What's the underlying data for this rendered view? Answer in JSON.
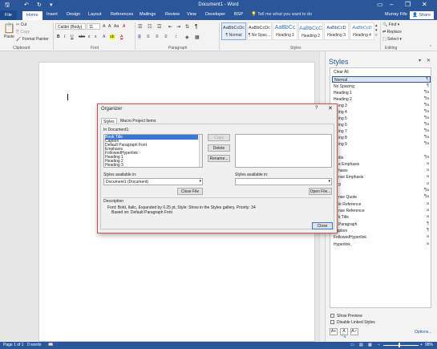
{
  "window": {
    "title": "Document1 - Word"
  },
  "quick_access": [
    "save-icon",
    "undo-icon",
    "redo-icon",
    "customize-icon"
  ],
  "window_controls": [
    "ribbon-display-icon",
    "minimize-icon",
    "restore-icon",
    "close-icon"
  ],
  "tabs": [
    "File",
    "Home",
    "Insert",
    "Design",
    "Layout",
    "References",
    "Mailings",
    "Review",
    "View",
    "Developer",
    "BSP"
  ],
  "tell_me": "Tell me what you want to do",
  "user": "Murray Fife",
  "share": "Share",
  "ribbon": {
    "clipboard": {
      "paste": "Paste",
      "cut": "Cut",
      "copy": "Copy",
      "format_painter": "Format Painter",
      "label": "Clipboard"
    },
    "font": {
      "name": "Calibri (Body)",
      "size": "11",
      "grow": "A",
      "shrink": "A",
      "case": "Aa",
      "clear": "A",
      "bold": "B",
      "italic": "I",
      "underline": "U",
      "strike": "abc",
      "sub": "x",
      "sup": "x",
      "effects": "A",
      "highlight": "ab",
      "color": "A",
      "label": "Font"
    },
    "paragraph": {
      "label": "Paragraph",
      "show": "¶"
    },
    "styles": {
      "label": "Styles",
      "tiles": [
        {
          "preview": "AaBbCcDc",
          "name": "¶ Normal"
        },
        {
          "preview": "AaBbCcDc",
          "name": "¶ No Spac..."
        },
        {
          "preview": "AaBbCc",
          "name": "Heading 1"
        },
        {
          "preview": "AaBbCcC",
          "name": "Heading 2"
        },
        {
          "preview": "AaBbCcD",
          "name": "Heading 3"
        },
        {
          "preview": "AaBbCcD",
          "name": "Heading 4"
        }
      ]
    },
    "editing": {
      "find": "Find",
      "replace": "Replace",
      "select": "Select",
      "label": "Editing"
    }
  },
  "styles_pane": {
    "title": "Styles",
    "items": [
      {
        "label": "Clear All",
        "indicator": ""
      },
      {
        "label": "Normal",
        "indicator": "¶"
      },
      {
        "label": "No Spacing",
        "indicator": "¶"
      },
      {
        "label": "Heading 1",
        "indicator": "¶a"
      },
      {
        "label": "Heading 2",
        "indicator": "¶a"
      },
      {
        "label": "ing 3",
        "indicator": "¶a"
      },
      {
        "label": "ing 4",
        "indicator": "¶a"
      },
      {
        "label": "ing 5",
        "indicator": "¶a"
      },
      {
        "label": "ing 6",
        "indicator": "¶a"
      },
      {
        "label": "ing 7",
        "indicator": "¶a"
      },
      {
        "label": "ing 8",
        "indicator": "¶a"
      },
      {
        "label": "ing 9",
        "indicator": "¶a"
      },
      {
        "label": "",
        "indicator": ""
      },
      {
        "label": "itle",
        "indicator": "¶a"
      },
      {
        "label": "e Emphasis",
        "indicator": "a"
      },
      {
        "label": "hasis",
        "indicator": "a"
      },
      {
        "label": "nse Emphasis",
        "indicator": "a"
      },
      {
        "label": "g",
        "indicator": "a"
      },
      {
        "label": "",
        "indicator": "¶a"
      },
      {
        "label": "nse Quote",
        "indicator": "¶a"
      },
      {
        "label": "le Reference",
        "indicator": "a"
      },
      {
        "label": "nse Reference",
        "indicator": "a"
      },
      {
        "label": "k Title",
        "indicator": "a"
      },
      {
        "label": "Paragraph",
        "indicator": "¶"
      },
      {
        "label": "Caption",
        "indicator": "¶"
      },
      {
        "label": "FollowedHyperlink",
        "indicator": "a"
      },
      {
        "label": "Hyperlink",
        "indicator": "a"
      }
    ],
    "show_preview": "Show Preview",
    "disable_linked": "Disable Linked Styles",
    "options": "Options..."
  },
  "status": {
    "page": "Page 1 of 1",
    "words": "0 words",
    "zoom": "98%"
  },
  "dialog": {
    "title": "Organizer",
    "help": "?",
    "close": "✕",
    "tabs": [
      "Styles",
      "Macro Project Items"
    ],
    "in_label": "In Document1:",
    "styles_list": [
      "Book Title",
      "Caption",
      "Default Paragraph Font",
      "Emphasis",
      "FollowedHyperlink",
      "Heading 1",
      "Heading 2",
      "Heading 3"
    ],
    "copy_btn": "Copy",
    "delete_btn": "Delete",
    "rename_btn": "Rename...",
    "available_left_label": "Styles available in:",
    "available_left_value": "Document1 (Document)",
    "available_right_label": "Styles available in:",
    "close_file": "Close File",
    "open_file": "Open File...",
    "description_label": "Description",
    "description_line1": "Font: Bold, Italic, Expanded by 0.25 pt, Style: Show in the Styles gallery, Priority: 34",
    "description_line2": "Based on: Default Paragraph Font",
    "close_btn": "Close"
  },
  "colors": {
    "accent": "#2b579a",
    "dialog_border": "#c8544f",
    "selection": "#3a78d4"
  }
}
